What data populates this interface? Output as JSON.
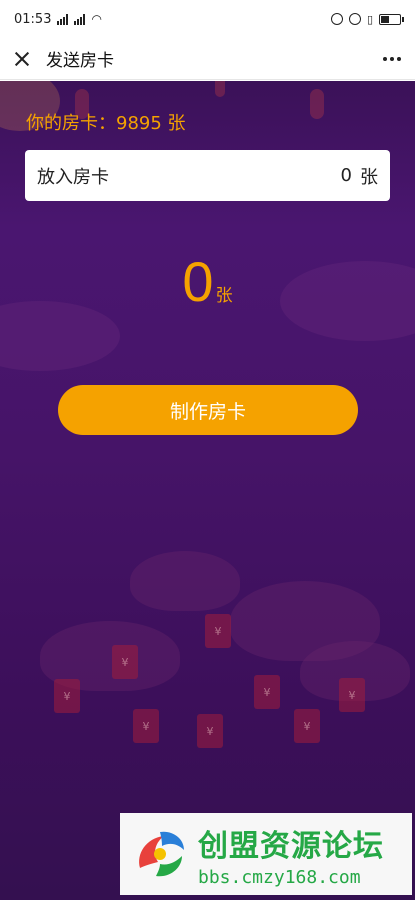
{
  "status_bar": {
    "time": "01:53",
    "signal_1": "4G",
    "signal_2": "4G"
  },
  "nav": {
    "title": "发送房卡"
  },
  "my_cards": {
    "label": "你的房卡：9895 张"
  },
  "card_input": {
    "label": "放入房卡",
    "value": "0",
    "unit": "张"
  },
  "big_count": {
    "value": "0",
    "unit": "张"
  },
  "make_button": {
    "label": "制作房卡"
  },
  "envelope_glyph": "¥",
  "watermark": {
    "name": "创盟资源论坛",
    "url": "bbs.cmzy168.com"
  },
  "colors": {
    "accent": "#f5a200",
    "background": "#461468",
    "watermark_green": "#25a846"
  }
}
